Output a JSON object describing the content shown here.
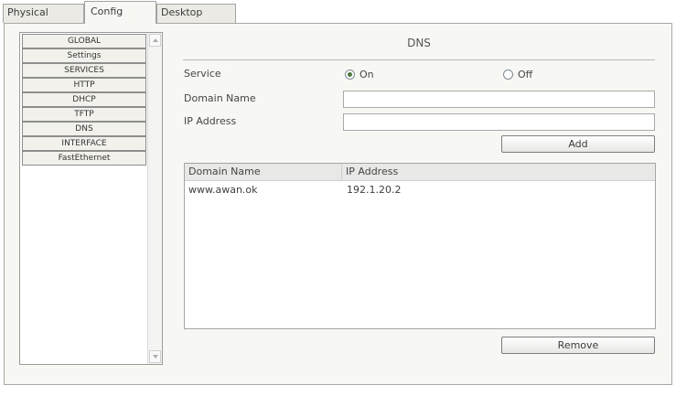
{
  "tabs": [
    {
      "label": "Physical",
      "active": false
    },
    {
      "label": "Config",
      "active": true
    },
    {
      "label": "Desktop",
      "active": false
    }
  ],
  "sidebar": {
    "items": [
      {
        "label": "GLOBAL"
      },
      {
        "label": "Settings"
      },
      {
        "label": "SERVICES"
      },
      {
        "label": "HTTP"
      },
      {
        "label": "DHCP"
      },
      {
        "label": "TFTP"
      },
      {
        "label": "DNS"
      },
      {
        "label": "INTERFACE"
      },
      {
        "label": "FastEthernet"
      }
    ]
  },
  "dns": {
    "title": "DNS",
    "service": {
      "label": "Service",
      "options": [
        {
          "label": "On",
          "checked": true
        },
        {
          "label": "Off",
          "checked": false
        }
      ]
    },
    "domain_name": {
      "label": "Domain Name",
      "value": ""
    },
    "ip_address": {
      "label": "IP Address",
      "value": ""
    },
    "add_label": "Add",
    "table": {
      "columns": [
        "Domain Name",
        "IP Address"
      ],
      "rows": [
        [
          "www.awan.ok",
          "192.1.20.2"
        ]
      ]
    },
    "remove_label": "Remove"
  }
}
